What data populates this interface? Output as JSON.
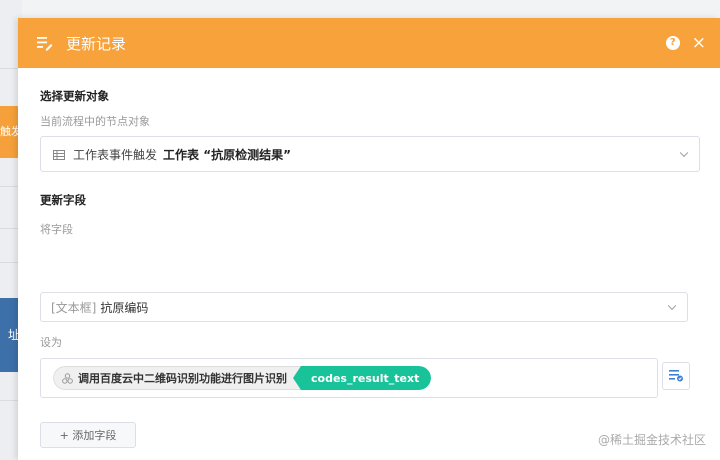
{
  "background": {
    "orange_text": "触发",
    "blue_text": "址"
  },
  "panel": {
    "title": "更新记录",
    "help_glyph": "?",
    "close_glyph": "×"
  },
  "target": {
    "section_title": "选择更新对象",
    "hint": "当前流程中的节点对象",
    "select_prefix": "工作表事件触发",
    "select_value": "工作表 “抗原检测结果”"
  },
  "fields": {
    "section_title": "更新字段",
    "field_label": "将字段",
    "field_type": "[文本框]",
    "field_name": "抗原编码",
    "set_label": "设为",
    "token_node": "调用百度云中二维码识别功能进行图片识别",
    "token_field": "codes_result_text"
  },
  "actions": {
    "add_field": "+ 添加字段"
  },
  "watermark": "@稀土掘金技术社区",
  "colors": {
    "header": "#f7a23b",
    "token_field": "#19c39a",
    "bg_orange": "#f5a03a",
    "bg_blue": "#3d6fa8"
  }
}
